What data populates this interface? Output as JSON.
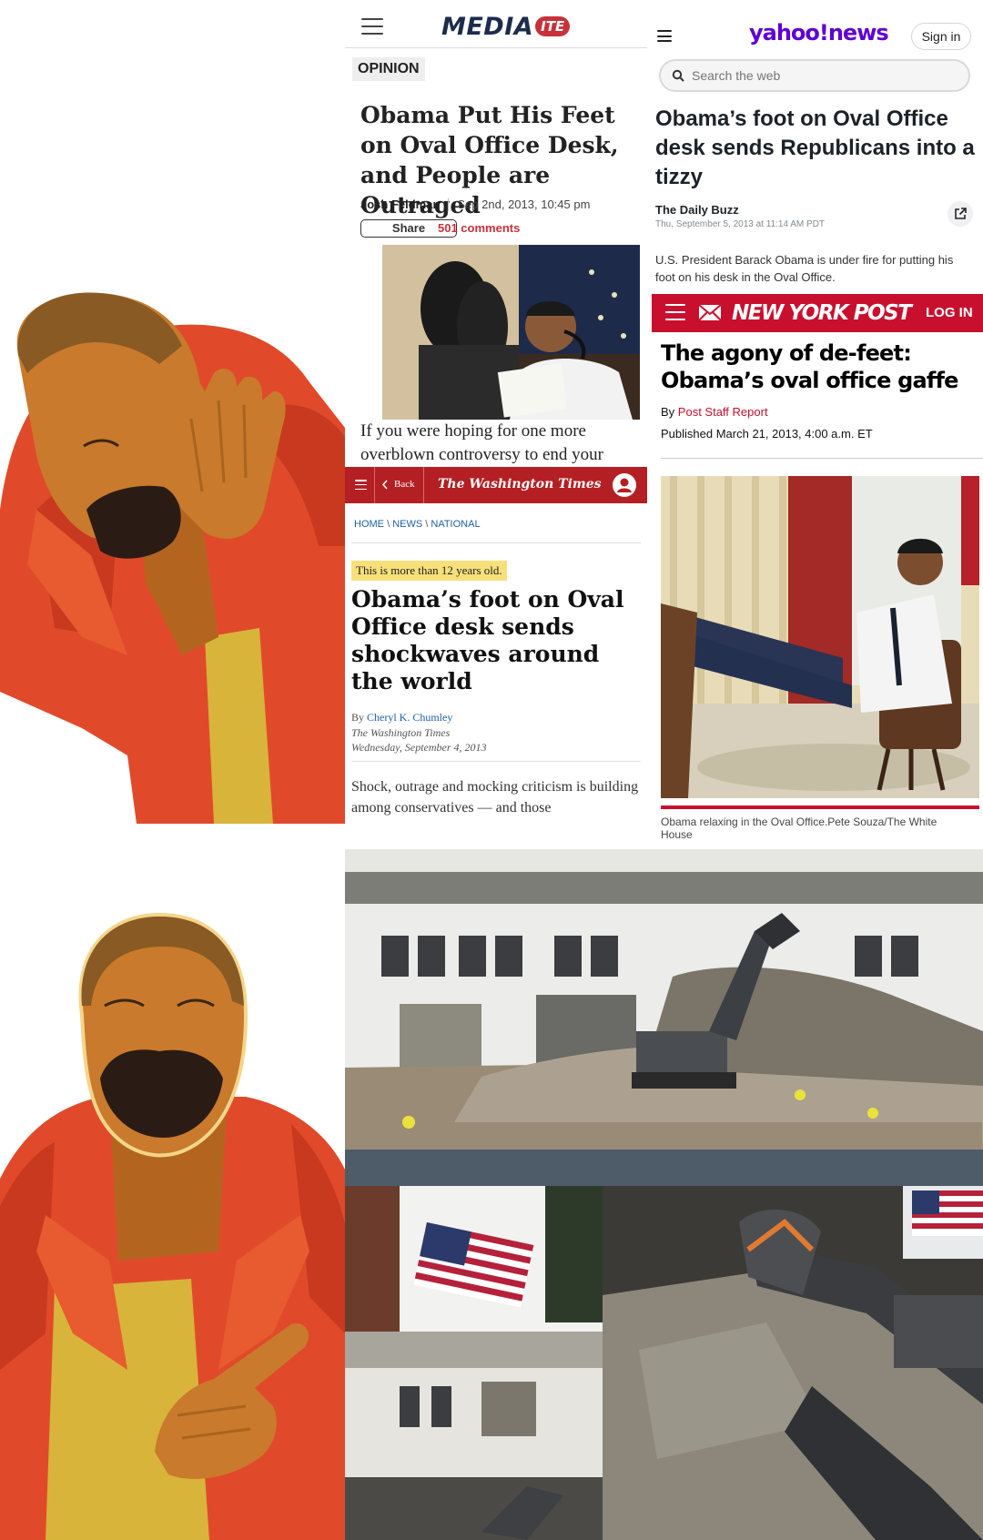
{
  "mediaite": {
    "logo_main": "MEDIA",
    "logo_badge": "ITE",
    "section": "OPINION",
    "headline": "Obama Put His Feet on Oval Office Desk, and People are Outraged",
    "author": "Josh Feldman",
    "date": "Sep 2nd, 2013, 10:45 pm",
    "share_label": "Share",
    "comments": "501 comments",
    "body_snippet": "If you were hoping for one more overblown controversy to end your"
  },
  "yahoo": {
    "logo": "yahoo!news",
    "sign_in": "Sign in",
    "search_placeholder": "Search the web",
    "headline": "Obama’s foot on Oval Office desk sends Republicans into a tizzy",
    "source": "The Daily Buzz",
    "date": "Thu, September 5, 2013 at 11:14 AM PDT",
    "snippet": "U.S. President Barack Obama is under fire for putting his foot on his desk in the Oval Office."
  },
  "nypost": {
    "logo": "NEW YORK POST",
    "login": "LOG IN",
    "headline": "The agony of de-feet: Obama’s oval office gaffe",
    "by_label": "By",
    "author": "Post Staff Report",
    "published": "Published March 21, 2013, 4:00 a.m. ET",
    "caption": "Obama relaxing in the Oval Office.Pete Souza/The White House"
  },
  "wtimes": {
    "back": "Back",
    "logo": "The Washington Times",
    "breadcrumb": [
      "HOME",
      "NEWS",
      "NATIONAL"
    ],
    "age_notice": "This is more than 12 years old.",
    "headline": "Obama’s foot on Oval Office desk sends shockwaves around the world",
    "by_label": "By",
    "author": "Cheryl K. Chumley",
    "publication": "The Washington Times",
    "date": "Wednesday, September 4, 2013",
    "body_snippet": "Shock, outrage and mocking criticism is building among conservatives — and those"
  },
  "colors": {
    "mediaite_red": "#c8313a",
    "mediaite_navy": "#1c2c4c",
    "yahoo_purple": "#6001d2",
    "nypost_red": "#c8102e",
    "wtimes_red": "#b41f24",
    "wtimes_link": "#1d5fa7",
    "highlight_yellow": "#f7e07a",
    "meme_orange": "#e04a2a",
    "meme_skin": "#c97a2c",
    "meme_yellow": "#d8b43a"
  },
  "icons": {
    "menu": "hamburger-icon",
    "search": "search-icon",
    "share": "external-link-icon",
    "mail": "mail-icon",
    "back": "chevron-left-icon",
    "account": "user-icon"
  }
}
